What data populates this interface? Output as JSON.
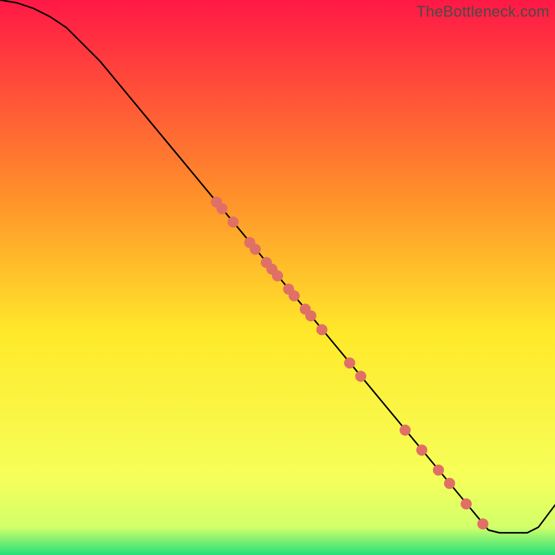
{
  "watermark": "TheBottleneck.com",
  "colors": {
    "gradient_top": "#ff1846",
    "gradient_mid_upper": "#ff8f2a",
    "gradient_mid": "#ffe92a",
    "gradient_lower": "#f6ff5a",
    "gradient_bottom": "#23e07a",
    "line": "#000000",
    "marker_fill": "#e07066",
    "marker_stroke": "#c95a52"
  },
  "chart_data": {
    "type": "line",
    "title": "",
    "xlabel": "",
    "ylabel": "",
    "xlim": [
      0,
      100
    ],
    "ylim": [
      0,
      100
    ],
    "series": [
      {
        "name": "curve",
        "x": [
          0,
          3,
          6,
          9,
          12,
          15,
          18,
          88,
          90,
          95,
          97,
          100
        ],
        "y": [
          100,
          99.5,
          98.5,
          97,
          95,
          92,
          89,
          4.5,
          4,
          4,
          5,
          9
        ]
      }
    ],
    "markers": {
      "name": "points-on-curve",
      "x": [
        39,
        40,
        42,
        45,
        46,
        48,
        49,
        50,
        52,
        53,
        55,
        56,
        58,
        63,
        65,
        73,
        76,
        79,
        81,
        84,
        87
      ],
      "y": [
        63.6,
        62.4,
        60.0,
        56.3,
        55.1,
        52.7,
        51.5,
        50.3,
        47.9,
        46.7,
        44.3,
        43.1,
        40.6,
        34.6,
        32.2,
        22.5,
        18.9,
        15.3,
        12.9,
        9.2,
        5.6
      ],
      "size": 8
    }
  }
}
